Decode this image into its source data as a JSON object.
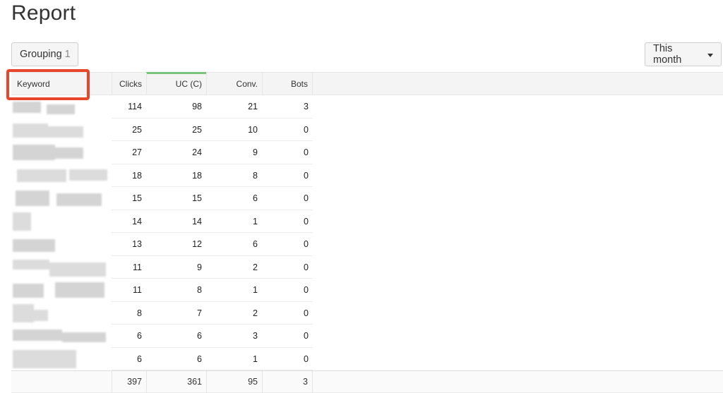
{
  "page": {
    "title": "Report"
  },
  "toolbar": {
    "grouping_label": "Grouping",
    "grouping_count": "1",
    "period_label": "This month"
  },
  "table": {
    "columns": [
      "Keyword",
      "Clicks",
      "UC (C)",
      "Conv.",
      "Bots"
    ],
    "sorted_column": "UC (C)",
    "rows": [
      {
        "keyword": "",
        "clicks": "114",
        "uc": "98",
        "conv": "21",
        "bots": "3"
      },
      {
        "keyword": "",
        "clicks": "25",
        "uc": "25",
        "conv": "10",
        "bots": "0"
      },
      {
        "keyword": "",
        "clicks": "27",
        "uc": "24",
        "conv": "9",
        "bots": "0"
      },
      {
        "keyword": "",
        "clicks": "18",
        "uc": "18",
        "conv": "8",
        "bots": "0"
      },
      {
        "keyword": "",
        "clicks": "15",
        "uc": "15",
        "conv": "6",
        "bots": "0"
      },
      {
        "keyword": "",
        "clicks": "14",
        "uc": "14",
        "conv": "1",
        "bots": "0"
      },
      {
        "keyword": "",
        "clicks": "13",
        "uc": "12",
        "conv": "6",
        "bots": "0"
      },
      {
        "keyword": "",
        "clicks": "11",
        "uc": "9",
        "conv": "2",
        "bots": "0"
      },
      {
        "keyword": "",
        "clicks": "11",
        "uc": "8",
        "conv": "1",
        "bots": "0"
      },
      {
        "keyword": "",
        "clicks": "8",
        "uc": "7",
        "conv": "2",
        "bots": "0"
      },
      {
        "keyword": "",
        "clicks": "6",
        "uc": "6",
        "conv": "3",
        "bots": "0"
      },
      {
        "keyword": "",
        "clicks": "6",
        "uc": "6",
        "conv": "1",
        "bots": "0"
      }
    ],
    "totals": {
      "clicks": "397",
      "uc": "361",
      "conv": "95",
      "bots": "3"
    }
  },
  "colors": {
    "highlight": "#e8452a",
    "sort_indicator": "#7cc57f"
  },
  "icons": {
    "period_dropdown": "caret-down-icon"
  }
}
